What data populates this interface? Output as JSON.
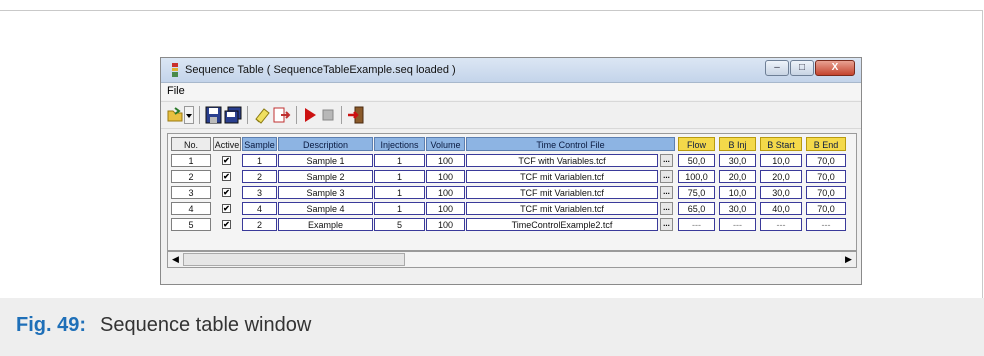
{
  "window": {
    "title": "Sequence Table ( SequenceTableExample.seq loaded )",
    "menu": [
      "File"
    ],
    "controls": {
      "minimize": "–",
      "maximize": "□",
      "close": "X"
    }
  },
  "toolbar": {
    "icons": [
      "open-folder-icon",
      "dropdown-arrow-icon",
      "save-icon",
      "save-as-icon",
      "eraser-icon",
      "insert-row-icon",
      "play-icon",
      "stop-icon",
      "exit-icon"
    ]
  },
  "table": {
    "columns": [
      "No.",
      "Active",
      "Sample",
      "Description",
      "Injections",
      "Volume",
      "Time Control File",
      "Flow",
      "B Inj",
      "B Start",
      "B End"
    ],
    "rows": [
      {
        "no": "1",
        "active": "✔",
        "sample": "1",
        "description": "Sample 1",
        "injections": "1",
        "volume": "100",
        "file": "TCF with Variables.tcf",
        "btn": "...",
        "flow": "50,0",
        "b_inj": "30,0",
        "b_start": "10,0",
        "b_end": "70,0"
      },
      {
        "no": "2",
        "active": "✔",
        "sample": "2",
        "description": "Sample 2",
        "injections": "1",
        "volume": "100",
        "file": "TCF mit Variablen.tcf",
        "btn": "...",
        "flow": "100,0",
        "b_inj": "20,0",
        "b_start": "20,0",
        "b_end": "70,0"
      },
      {
        "no": "3",
        "active": "✔",
        "sample": "3",
        "description": "Sample 3",
        "injections": "1",
        "volume": "100",
        "file": "TCF mit Variablen.tcf",
        "btn": "...",
        "flow": "75,0",
        "b_inj": "10,0",
        "b_start": "30,0",
        "b_end": "70,0"
      },
      {
        "no": "4",
        "active": "✔",
        "sample": "4",
        "description": "Sample 4",
        "injections": "1",
        "volume": "100",
        "file": "TCF mit Variablen.tcf",
        "btn": "...",
        "flow": "65,0",
        "b_inj": "30,0",
        "b_start": "40,0",
        "b_end": "70,0"
      },
      {
        "no": "5",
        "active": "✔",
        "sample": "2",
        "description": "Example",
        "injections": "5",
        "volume": "100",
        "file": "TimeControlExample2.tcf",
        "btn": "...",
        "flow": "---",
        "b_inj": "---",
        "b_start": "---",
        "b_end": "---"
      }
    ]
  },
  "scrollbar": {
    "left": "◀",
    "right": "▶"
  },
  "caption": {
    "number": "Fig. 49:",
    "text": "Sequence table window"
  },
  "colors": {
    "accent": "#1e6fb8",
    "header_blue": "#8db4e3",
    "header_yellow": "#f4d94a",
    "cell_border": "#3a3a9a"
  }
}
